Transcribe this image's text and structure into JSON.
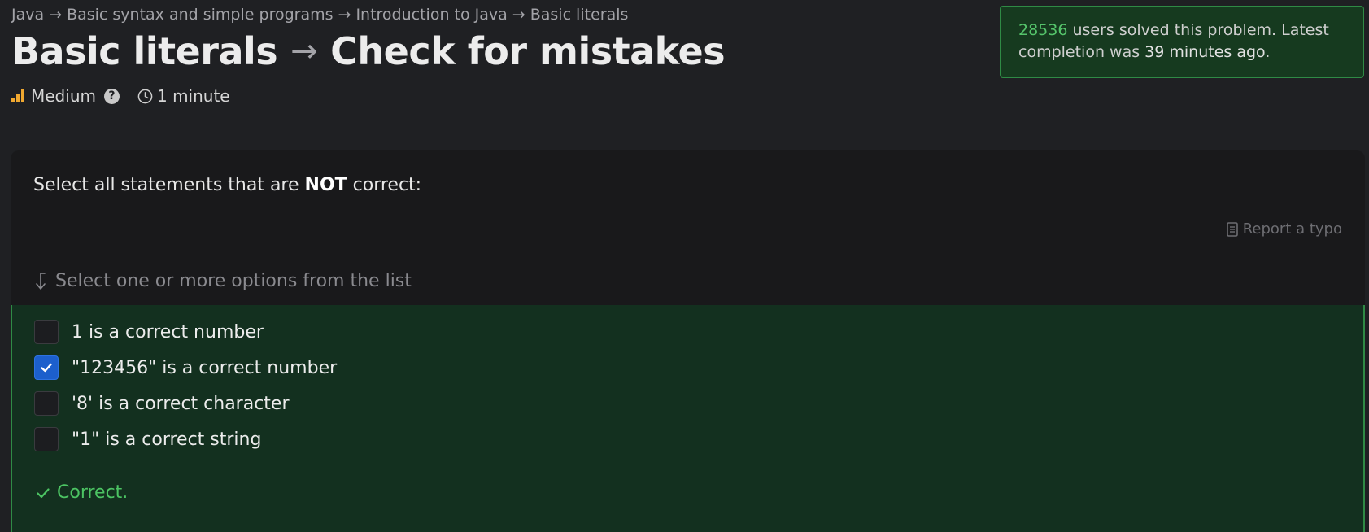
{
  "breadcrumb": [
    {
      "label": "Java"
    },
    {
      "label": "Basic syntax and simple programs"
    },
    {
      "label": "Introduction to Java"
    },
    {
      "label": "Basic literals"
    }
  ],
  "breadcrumb_separator": "→",
  "title": {
    "topic": "Basic literals",
    "arrow": "→",
    "stage": "Check for mistakes"
  },
  "meta": {
    "difficulty": "Medium",
    "help_symbol": "?",
    "duration": "1 minute",
    "difficulty_icon": "bars-icon",
    "duration_icon": "clock-icon"
  },
  "solved": {
    "count": "28536",
    "text_after_count": " users solved this problem. Latest completion was ",
    "ago": "39 minutes ago",
    "end": "."
  },
  "question": {
    "prefix": "Select all statements that are ",
    "emphasis": "NOT",
    "suffix": " correct:"
  },
  "report_typo": "Report a typo",
  "hint": "Select one or more options from the list",
  "options": [
    {
      "label": "1 is a correct number",
      "checked": false
    },
    {
      "label": "\"123456\" is a correct number",
      "checked": true
    },
    {
      "label": "'8' is a correct character",
      "checked": false
    },
    {
      "label": "\"1\" is a correct string",
      "checked": false
    }
  ],
  "result": "Correct.",
  "colors": {
    "background": "#1f2023",
    "card": "#19191b",
    "success_bg": "#13301f",
    "success_border": "#2f8a45",
    "success_text": "#4cc463",
    "checkbox_checked": "#1c5fcc",
    "difficulty_bars": "#f0a830"
  }
}
